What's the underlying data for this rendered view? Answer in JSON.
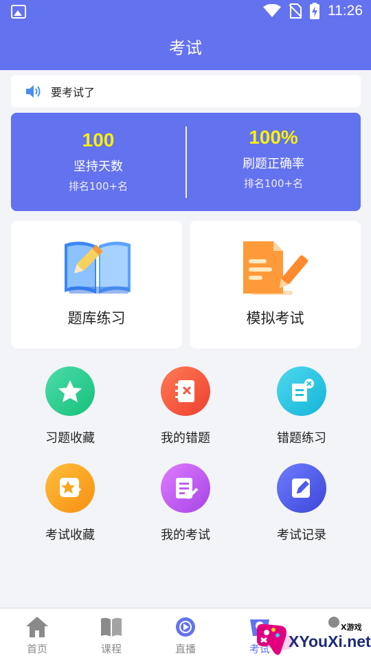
{
  "status_bar": {
    "time": "11:26"
  },
  "header": {
    "title": "考试"
  },
  "notice": {
    "text": "要考试了"
  },
  "stats": [
    {
      "value": "100",
      "label": "坚持天数",
      "rank": "排名100+名"
    },
    {
      "value": "100%",
      "label": "刷题正确率",
      "rank": "排名100+名"
    }
  ],
  "cards": [
    {
      "label": "题库练习",
      "icon": "book-pencil-icon"
    },
    {
      "label": "模拟考试",
      "icon": "document-pen-icon"
    }
  ],
  "tools": [
    {
      "label": "习题收藏",
      "icon": "star-icon",
      "color": "#2fcf8f"
    },
    {
      "label": "我的错题",
      "icon": "notebook-x-icon",
      "color": "#f5573d"
    },
    {
      "label": "错题练习",
      "icon": "scroll-x-icon",
      "color": "#22c2e0"
    },
    {
      "label": "考试收藏",
      "icon": "star-note-icon",
      "color": "#f9a51a"
    },
    {
      "label": "我的考试",
      "icon": "document-edit-icon",
      "color": "#c05cf0"
    },
    {
      "label": "考试记录",
      "icon": "edit-record-icon",
      "color": "#4f5be8"
    }
  ],
  "tabs": [
    {
      "label": "首页",
      "icon": "home-icon"
    },
    {
      "label": "课程",
      "icon": "book-icon"
    },
    {
      "label": "直播",
      "icon": "live-icon"
    },
    {
      "label": "考试",
      "icon": "exam-icon",
      "active": true
    }
  ],
  "watermark": {
    "text": "XYouXi.net",
    "small": "X游戏"
  },
  "colors": {
    "primary": "#6372ee",
    "stat_value": "#f9f00b"
  }
}
